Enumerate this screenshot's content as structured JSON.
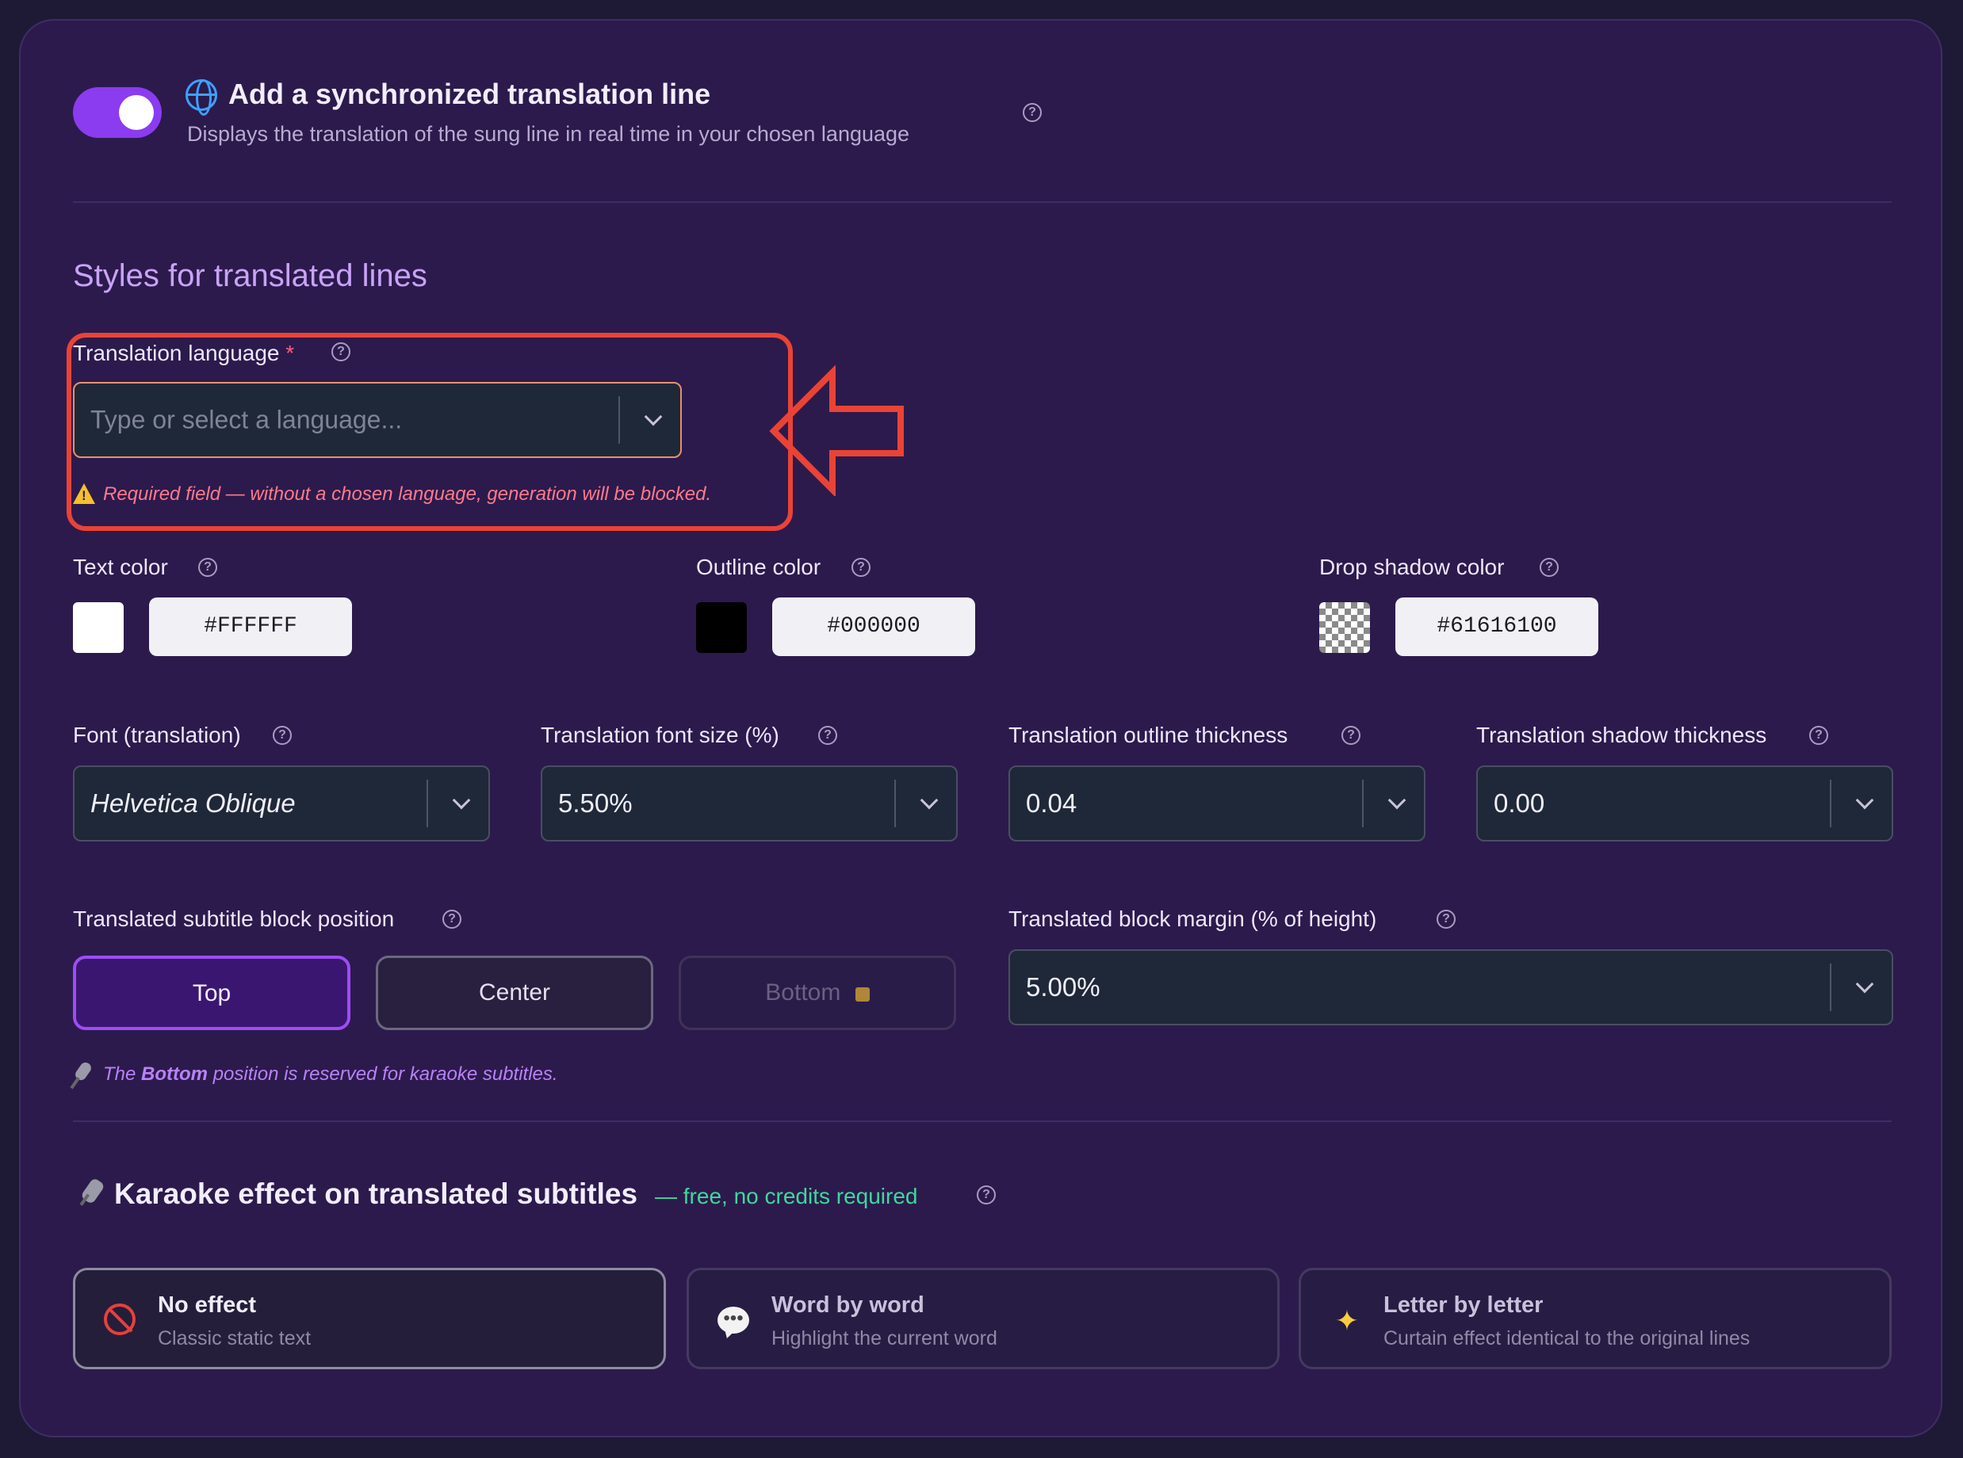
{
  "header": {
    "title": "Add a synchronized translation line",
    "subtitle": "Displays the translation of the sung line in real time in your chosen language",
    "toggle_on": true
  },
  "styles_section": {
    "title": "Styles for translated lines"
  },
  "language": {
    "label": "Translation language",
    "required_mark": "*",
    "placeholder": "Type or select a language...",
    "warning": "Required field — without a chosen language, generation will be blocked."
  },
  "colors": {
    "text": {
      "label": "Text color",
      "hex": "#FFFFFF",
      "swatch": "#FFFFFF"
    },
    "outline": {
      "label": "Outline color",
      "hex": "#000000",
      "swatch": "#000000"
    },
    "shadow": {
      "label": "Drop shadow color",
      "hex": "#61616100",
      "swatch": "transparent"
    }
  },
  "font": {
    "label": "Font (translation)",
    "value": "Helvetica Oblique"
  },
  "font_size": {
    "label": "Translation font size (%)",
    "value": "5.50%"
  },
  "outline_thickness": {
    "label": "Translation outline thickness",
    "value": "0.04"
  },
  "shadow_thickness": {
    "label": "Translation shadow thickness",
    "value": "0.00"
  },
  "position": {
    "label": "Translated subtitle block position",
    "options": [
      "Top",
      "Center",
      "Bottom"
    ],
    "selected": "Top",
    "locked": "Bottom",
    "note_prefix": "The",
    "note_bold": "Bottom",
    "note_suffix": "position is reserved for karaoke subtitles."
  },
  "margin": {
    "label": "Translated block margin (% of height)",
    "value": "5.00%"
  },
  "karaoke": {
    "title": "Karaoke effect on translated subtitles",
    "badge": "— free, no credits required",
    "effects": [
      {
        "name": "No effect",
        "desc": "Classic static text",
        "icon": "no-entry-icon"
      },
      {
        "name": "Word by word",
        "desc": "Highlight the current word",
        "icon": "speech-bubble-icon"
      },
      {
        "name": "Letter by letter",
        "desc": "Curtain effect identical to the original lines",
        "icon": "sparkles-icon"
      }
    ],
    "selected": "No effect"
  },
  "accent_colors": {
    "toggle": "#8B3BF0",
    "callout": "#EA4335",
    "free_badge": "#3FD89B",
    "selected_position": "#9D4DF5"
  }
}
